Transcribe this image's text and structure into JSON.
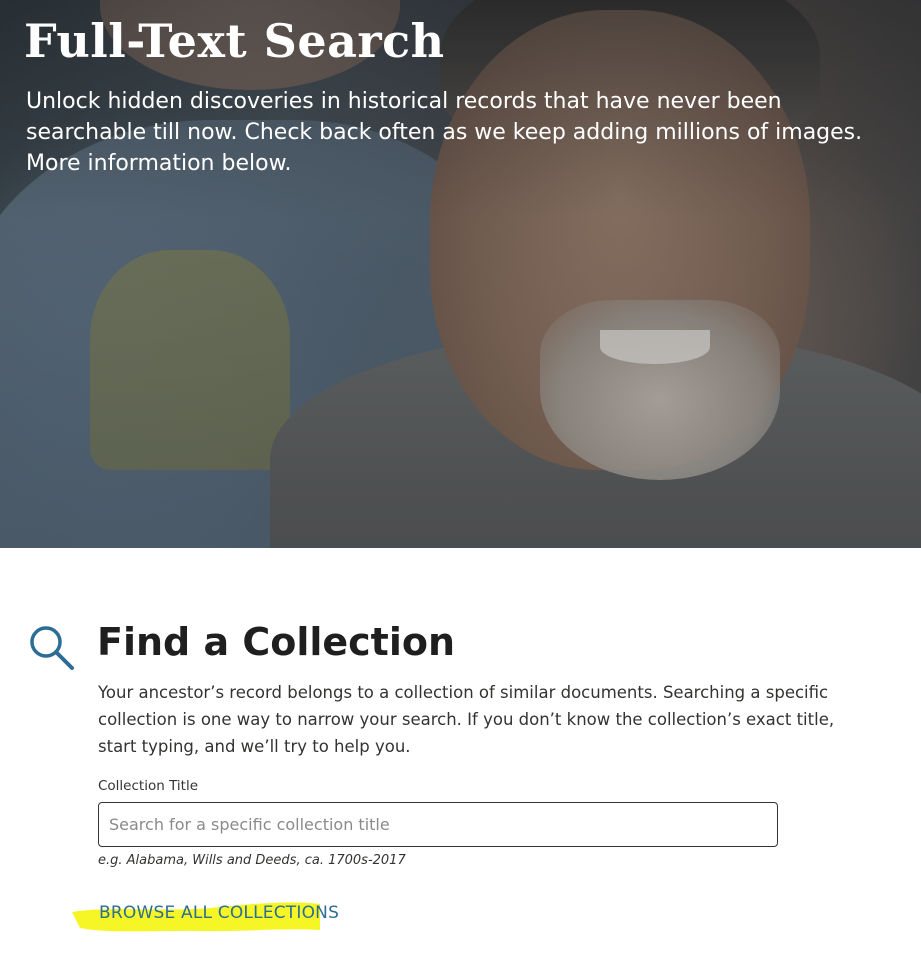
{
  "hero": {
    "title": "Full-Text Search",
    "description": "Unlock hidden discoveries in historical records that have never been searchable till now. Check back often as we keep adding millions of images. More information below."
  },
  "find_collection": {
    "icon": "search-icon",
    "title": "Find a Collection",
    "description": "Your ancestor’s record belongs to a collection of similar documents. Searching a specific collection is one way to narrow your search. If you don’t know the collection’s exact title, start typing, and we’ll try to help you.",
    "field_label": "Collection Title",
    "input_value": "",
    "input_placeholder": "Search for a specific collection title",
    "example": "e.g. Alabama, Wills and Deeds, ca. 1700s-2017",
    "browse_label": "BROWSE ALL COLLECTIONS"
  },
  "colors": {
    "link": "#2b6d95",
    "icon": "#2b6d95",
    "highlight": "#f5f500",
    "text": "#333331"
  }
}
